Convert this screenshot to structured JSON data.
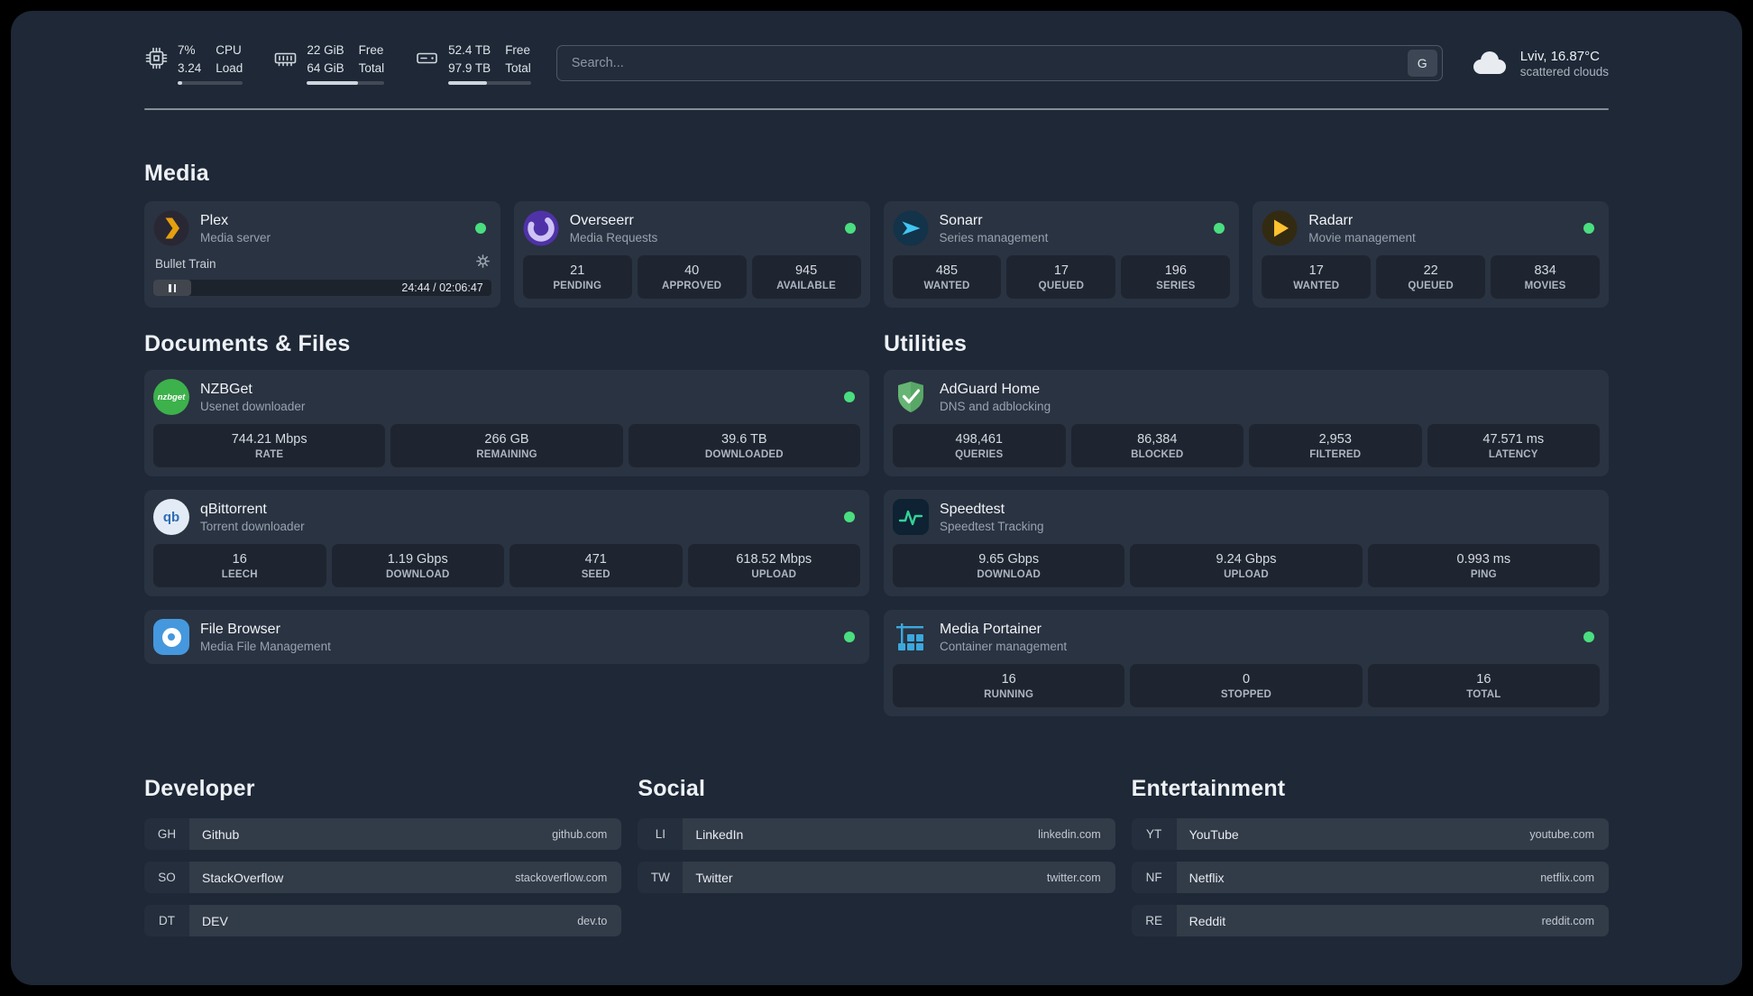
{
  "theme": {
    "status_green": "#4ade80"
  },
  "header": {
    "cpu": {
      "percent": "7%",
      "load": "3.24",
      "label_top": "CPU",
      "label_bottom": "Load"
    },
    "memory": {
      "free": "22 GiB",
      "total": "64 GiB",
      "label_top": "Free",
      "label_bottom": "Total"
    },
    "disk": {
      "free": "52.4 TB",
      "total": "97.9 TB",
      "label_top": "Free",
      "label_bottom": "Total"
    },
    "search": {
      "placeholder": "Search...",
      "provider_button": "G"
    },
    "weather": {
      "location": "Lviv, 16.87°C",
      "condition": "scattered clouds"
    }
  },
  "media": {
    "title": "Media",
    "cards": [
      {
        "name": "Plex",
        "subtitle": "Media server",
        "status": "online",
        "player": {
          "track": "Bullet Train",
          "time": "24:44 / 02:06:47"
        }
      },
      {
        "name": "Overseerr",
        "subtitle": "Media Requests",
        "status": "online",
        "stats": [
          {
            "value": "21",
            "label": "PENDING"
          },
          {
            "value": "40",
            "label": "APPROVED"
          },
          {
            "value": "945",
            "label": "AVAILABLE"
          }
        ]
      },
      {
        "name": "Sonarr",
        "subtitle": "Series management",
        "status": "online",
        "stats": [
          {
            "value": "485",
            "label": "WANTED"
          },
          {
            "value": "17",
            "label": "QUEUED"
          },
          {
            "value": "196",
            "label": "SERIES"
          }
        ]
      },
      {
        "name": "Radarr",
        "subtitle": "Movie management",
        "status": "online",
        "stats": [
          {
            "value": "17",
            "label": "WANTED"
          },
          {
            "value": "22",
            "label": "QUEUED"
          },
          {
            "value": "834",
            "label": "MOVIES"
          }
        ]
      }
    ]
  },
  "documents": {
    "title": "Documents & Files",
    "cards": [
      {
        "name": "NZBGet",
        "subtitle": "Usenet downloader",
        "status": "online",
        "stats": [
          {
            "value": "744.21 Mbps",
            "label": "RATE"
          },
          {
            "value": "266 GB",
            "label": "REMAINING"
          },
          {
            "value": "39.6 TB",
            "label": "DOWNLOADED"
          }
        ]
      },
      {
        "name": "qBittorrent",
        "subtitle": "Torrent downloader",
        "status": "online",
        "stats": [
          {
            "value": "16",
            "label": "LEECH"
          },
          {
            "value": "1.19 Gbps",
            "label": "DOWNLOAD"
          },
          {
            "value": "471",
            "label": "SEED"
          },
          {
            "value": "618.52 Mbps",
            "label": "UPLOAD"
          }
        ]
      },
      {
        "name": "File Browser",
        "subtitle": "Media File Management",
        "status": "online",
        "stats": []
      }
    ]
  },
  "utilities": {
    "title": "Utilities",
    "cards": [
      {
        "name": "AdGuard Home",
        "subtitle": "DNS and adblocking",
        "stats": [
          {
            "value": "498,461",
            "label": "QUERIES"
          },
          {
            "value": "86,384",
            "label": "BLOCKED"
          },
          {
            "value": "2,953",
            "label": "FILTERED"
          },
          {
            "value": "47.571 ms",
            "label": "LATENCY"
          }
        ]
      },
      {
        "name": "Speedtest",
        "subtitle": "Speedtest Tracking",
        "stats": [
          {
            "value": "9.65 Gbps",
            "label": "DOWNLOAD"
          },
          {
            "value": "9.24 Gbps",
            "label": "UPLOAD"
          },
          {
            "value": "0.993 ms",
            "label": "PING"
          }
        ]
      },
      {
        "name": "Media Portainer",
        "subtitle": "Container management",
        "status": "online",
        "stats": [
          {
            "value": "16",
            "label": "RUNNING"
          },
          {
            "value": "0",
            "label": "STOPPED"
          },
          {
            "value": "16",
            "label": "TOTAL"
          }
        ]
      }
    ]
  },
  "bookmarks": {
    "groups": [
      {
        "title": "Developer",
        "items": [
          {
            "abbr": "GH",
            "name": "Github",
            "domain": "github.com"
          },
          {
            "abbr": "SO",
            "name": "StackOverflow",
            "domain": "stackoverflow.com"
          },
          {
            "abbr": "DT",
            "name": "DEV",
            "domain": "dev.to"
          }
        ]
      },
      {
        "title": "Social",
        "items": [
          {
            "abbr": "LI",
            "name": "LinkedIn",
            "domain": "linkedin.com"
          },
          {
            "abbr": "TW",
            "name": "Twitter",
            "domain": "twitter.com"
          }
        ]
      },
      {
        "title": "Entertainment",
        "items": [
          {
            "abbr": "YT",
            "name": "YouTube",
            "domain": "youtube.com"
          },
          {
            "abbr": "NF",
            "name": "Netflix",
            "domain": "netflix.com"
          },
          {
            "abbr": "RE",
            "name": "Reddit",
            "domain": "reddit.com"
          }
        ]
      }
    ]
  },
  "icons": {
    "cpu": "cpu-chip-icon",
    "memory": "ram-icon",
    "disk": "hard-drive-icon",
    "weather": "cloud-icon",
    "settings": "gear-icon",
    "nzbget_label": "nzbget",
    "qbittorrent_label": "qb"
  }
}
